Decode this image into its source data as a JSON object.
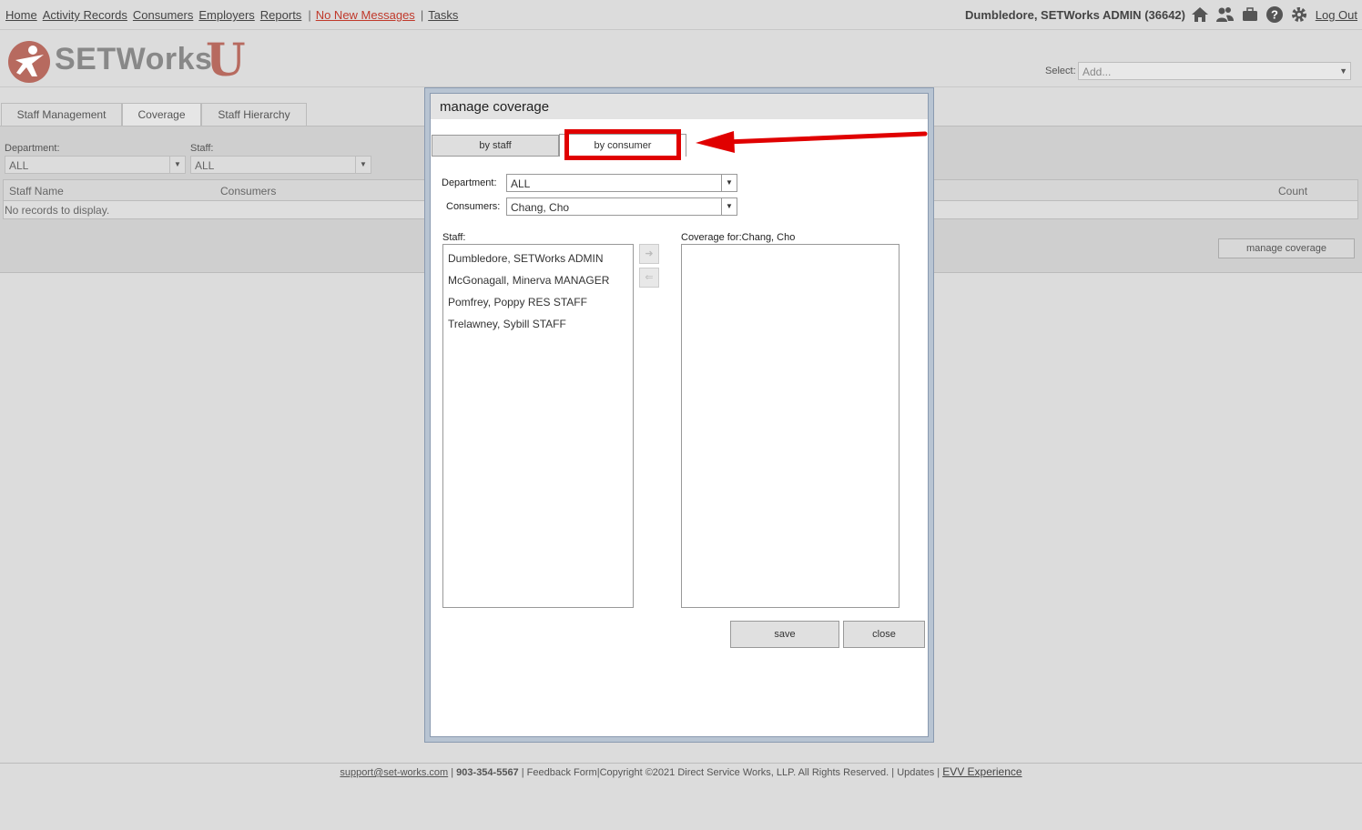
{
  "nav": {
    "home": "Home",
    "activity_records": "Activity Records",
    "consumers": "Consumers",
    "employers": "Employers",
    "reports": "Reports",
    "messages": "No New Messages",
    "tasks": "Tasks",
    "separator": "|"
  },
  "header": {
    "user": "Dumbledore, SETWorks ADMIN",
    "user_id": "(36642)",
    "icons": [
      "home-icon",
      "users-icon",
      "briefcase-icon",
      "help-icon",
      "gear-icon"
    ],
    "logout": "Log Out"
  },
  "logo": {
    "text": "SETWorks",
    "u": "U",
    "accent_color": "#b76a5f"
  },
  "select": {
    "label": "Select:",
    "value": "Add..."
  },
  "tabs": [
    {
      "label": "Staff Management"
    },
    {
      "label": "Coverage",
      "active": true
    },
    {
      "label": "Staff Hierarchy"
    }
  ],
  "filters": {
    "department_label": "Department:",
    "department_value": "ALL",
    "staff_label": "Staff:",
    "staff_value": "ALL"
  },
  "grid": {
    "columns": [
      "Staff Name",
      "Consumers",
      "Count"
    ],
    "empty_message": "No records to display."
  },
  "manage_coverage_button": "manage coverage",
  "dialog": {
    "title": "manage coverage",
    "by_staff": "by staff",
    "by_consumer": "by consumer",
    "department_label": "Department:",
    "department_value": "ALL",
    "consumers_label": "Consumers:",
    "consumers_value": "Chang, Cho",
    "staff_label": "Staff:",
    "staff_list": [
      "Dumbledore, SETWorks ADMIN",
      "McGonagall, Minerva MANAGER",
      "Pomfrey, Poppy RES STAFF",
      "Trelawney, Sybill STAFF"
    ],
    "coverage_label": "Coverage for:Chang, Cho",
    "move_right": "➜",
    "move_left": "⇐",
    "save": "save",
    "close": "close"
  },
  "annotation": {
    "color": "#e00000"
  },
  "footer": {
    "email": "support@set-works.com",
    "phone": "903-354-5567",
    "feedback": "Feedback Form",
    "copyright": "Copyright ©2021 Direct Service Works, LLP. All Rights Reserved.",
    "updates": "Updates",
    "evv": "EVV Experience"
  }
}
